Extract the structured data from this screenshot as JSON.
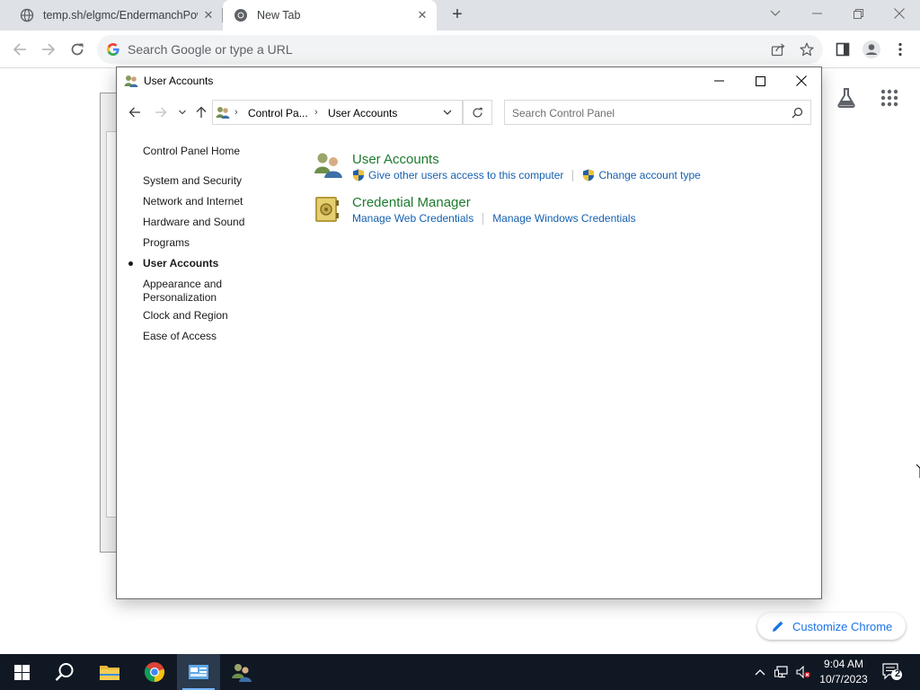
{
  "browser": {
    "tabs": [
      {
        "title": "temp.sh/elgmc/EndermanchPow",
        "active": false
      },
      {
        "title": "New Tab",
        "active": true
      }
    ],
    "omnibox_placeholder": "Search Google or type a URL",
    "customize_label": "Customize Chrome"
  },
  "window": {
    "title": "User Accounts",
    "breadcrumb": [
      "Control Pa...",
      "User Accounts"
    ],
    "search_placeholder": "Search Control Panel",
    "left_nav": [
      {
        "label": "Control Panel Home",
        "current": false
      },
      {
        "label": "System and Security",
        "current": false
      },
      {
        "label": "Network and Internet",
        "current": false
      },
      {
        "label": "Hardware and Sound",
        "current": false
      },
      {
        "label": "Programs",
        "current": false
      },
      {
        "label": "User Accounts",
        "current": true
      },
      {
        "label": "Appearance and",
        "current": false
      },
      {
        "label": "Personalization",
        "current": false
      },
      {
        "label": "Clock and Region",
        "current": false
      },
      {
        "label": "Ease of Access",
        "current": false
      }
    ],
    "categories": [
      {
        "title": "User Accounts",
        "icon": "users-icon",
        "links": [
          "Give other users access to this computer",
          "Change account type"
        ]
      },
      {
        "title": "Credential Manager",
        "icon": "vault-icon",
        "links": [
          "Manage Web Credentials",
          "Manage Windows Credentials"
        ]
      }
    ]
  },
  "taskbar": {
    "time": "9:04 AM",
    "date": "10/7/2023",
    "notification_count": "2"
  },
  "colors": {
    "taskbar_bg": "#101824",
    "category_title": "#1e7a2e",
    "link": "#1560b0",
    "chrome_blue": "#1a73e8"
  }
}
